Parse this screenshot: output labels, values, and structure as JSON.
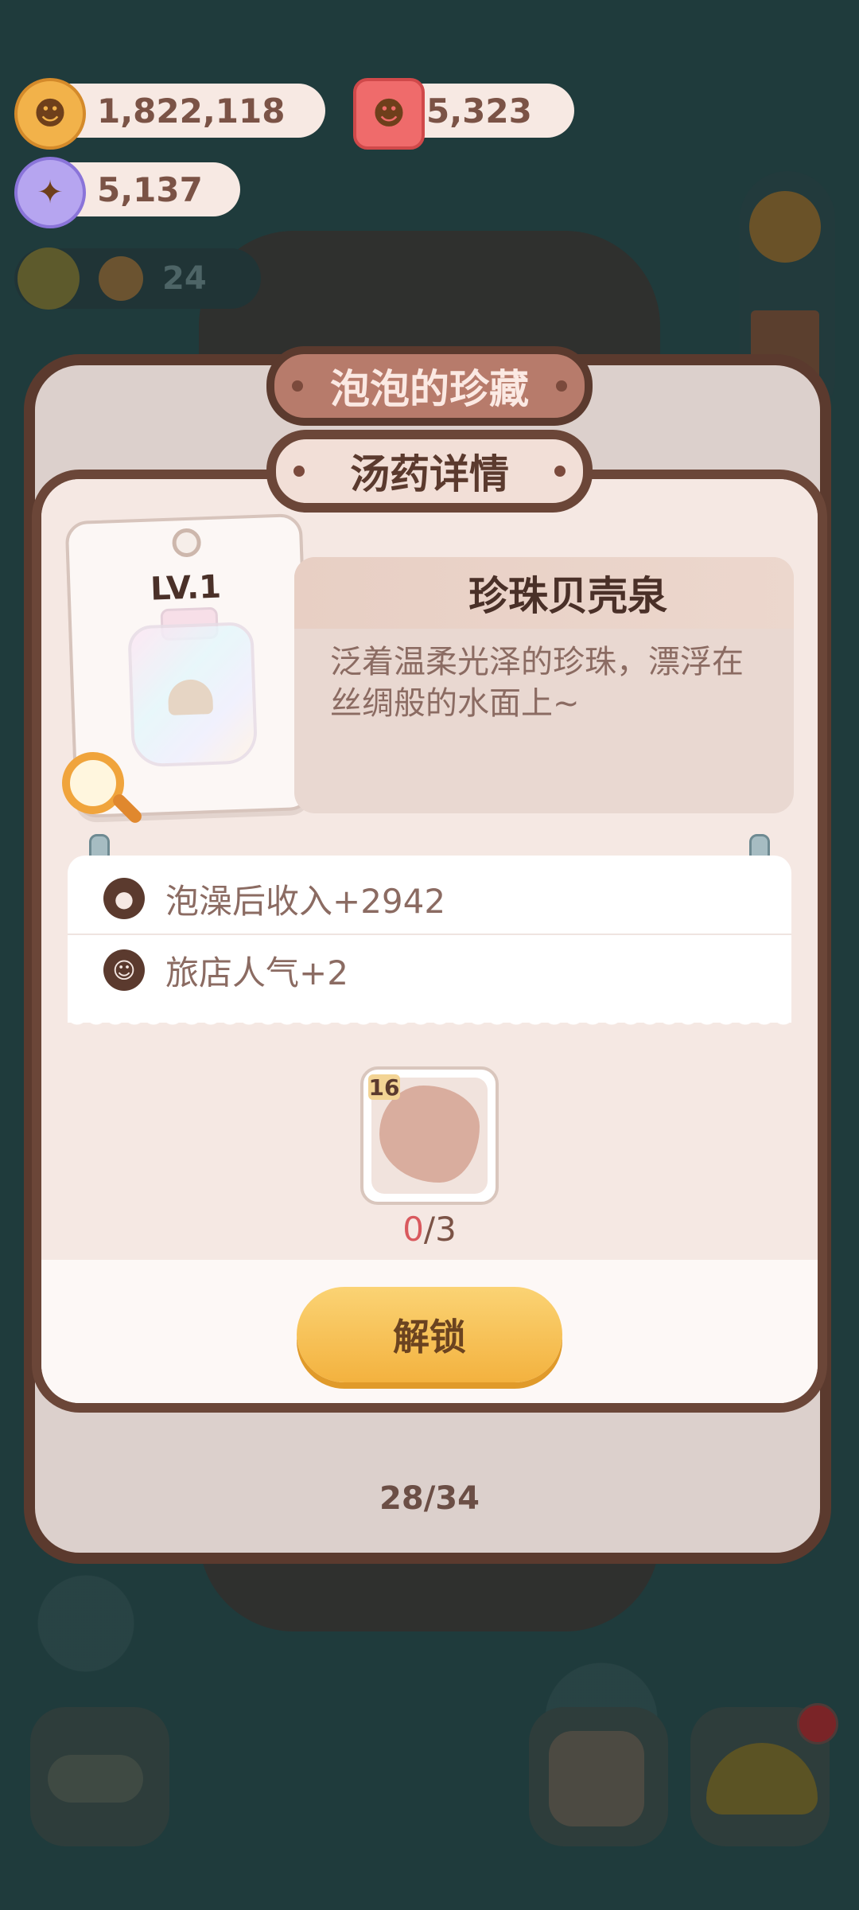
{
  "currencies": {
    "cookies": {
      "value": "1,822,118",
      "icon": "cookie-icon",
      "color": "#f2b24a"
    },
    "jelly": {
      "value": "5,323",
      "icon": "jelly-icon",
      "color": "#ef6b6b"
    },
    "candy": {
      "value": "5,137",
      "icon": "candy-icon",
      "color": "#b6a5f0"
    }
  },
  "background": {
    "guest_count": "24"
  },
  "window": {
    "title": "泡泡的珍藏",
    "subtitle": "汤药详情"
  },
  "potion": {
    "level": "LV.1",
    "name": "珍珠贝壳泉",
    "description": "泛着温柔光泽的珍珠，漂浮在丝绸般的水面上~"
  },
  "stats": [
    {
      "icon": "cookie-icon",
      "text": "泡澡后收入+2942"
    },
    {
      "icon": "guest-icon",
      "text": "旅店人气+2"
    }
  ],
  "requirement": {
    "item_level": "16",
    "have": "0",
    "total": "/3"
  },
  "actions": {
    "unlock_label": "解锁"
  },
  "pagination": {
    "label": "28/34"
  },
  "colors": {
    "brown_frame": "#5b3a2e",
    "button_yellow": "#f3b23f",
    "count_red": "#d9595e"
  }
}
